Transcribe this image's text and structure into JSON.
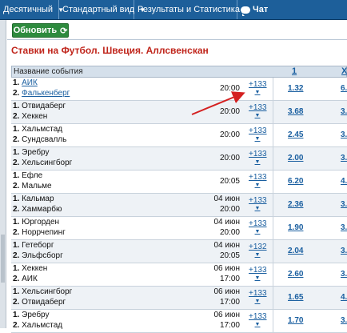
{
  "topbar": {
    "items": [
      "Десятичный",
      "Стандартный вид",
      "Результаты и Статистика"
    ],
    "chat": "Чат"
  },
  "refresh_label": "Обновить",
  "title": "Ставки на Футбол. Швеция. Аллсвенскан",
  "table": {
    "col_event": "Название события",
    "col_1": "1",
    "col_x": "X",
    "rows": [
      {
        "home": "АИК",
        "away": "Фалькенберг",
        "date": "",
        "time": "20:00",
        "more": "+133",
        "o1": "1.32",
        "o2": "6."
      },
      {
        "home": "Отвидаберг",
        "away": "Хеккен",
        "date": "",
        "time": "20:00",
        "more": "+133",
        "o1": "3.68",
        "o2": "3."
      },
      {
        "home": "Хальмстад",
        "away": "Сундсвалль",
        "date": "",
        "time": "20:00",
        "more": "+133",
        "o1": "2.45",
        "o2": "3."
      },
      {
        "home": "Эребру",
        "away": "Хельсингборг",
        "date": "",
        "time": "20:00",
        "more": "+133",
        "o1": "2.00",
        "o2": "3."
      },
      {
        "home": "Ефле",
        "away": "Мальме",
        "date": "",
        "time": "20:05",
        "more": "+133",
        "o1": "6.20",
        "o2": "4."
      },
      {
        "home": "Кальмар",
        "away": "Хаммарбю",
        "date": "04 июн",
        "time": "20:00",
        "more": "+133",
        "o1": "2.36",
        "o2": "3."
      },
      {
        "home": "Юргорден",
        "away": "Норрчепинг",
        "date": "04 июн",
        "time": "20:00",
        "more": "+133",
        "o1": "1.90",
        "o2": "3."
      },
      {
        "home": "Гетеборг",
        "away": "Эльфсборг",
        "date": "04 июн",
        "time": "20:05",
        "more": "+132",
        "o1": "2.04",
        "o2": "3."
      },
      {
        "home": "Хеккен",
        "away": "АИК",
        "date": "06 июн",
        "time": "17:00",
        "more": "+133",
        "o1": "2.60",
        "o2": "3."
      },
      {
        "home": "Хельсингборг",
        "away": "Отвидаберг",
        "date": "06 июн",
        "time": "17:00",
        "more": "+133",
        "o1": "1.65",
        "o2": "4."
      },
      {
        "home": "Эребру",
        "away": "Хальмстад",
        "date": "06 июн",
        "time": "17:00",
        "more": "+133",
        "o1": "1.70",
        "o2": "3."
      }
    ]
  },
  "colors": {
    "accent": "#1d5f9a",
    "title": "#c0261c",
    "button": "#2e8b3e",
    "arrow": "#d42020"
  }
}
